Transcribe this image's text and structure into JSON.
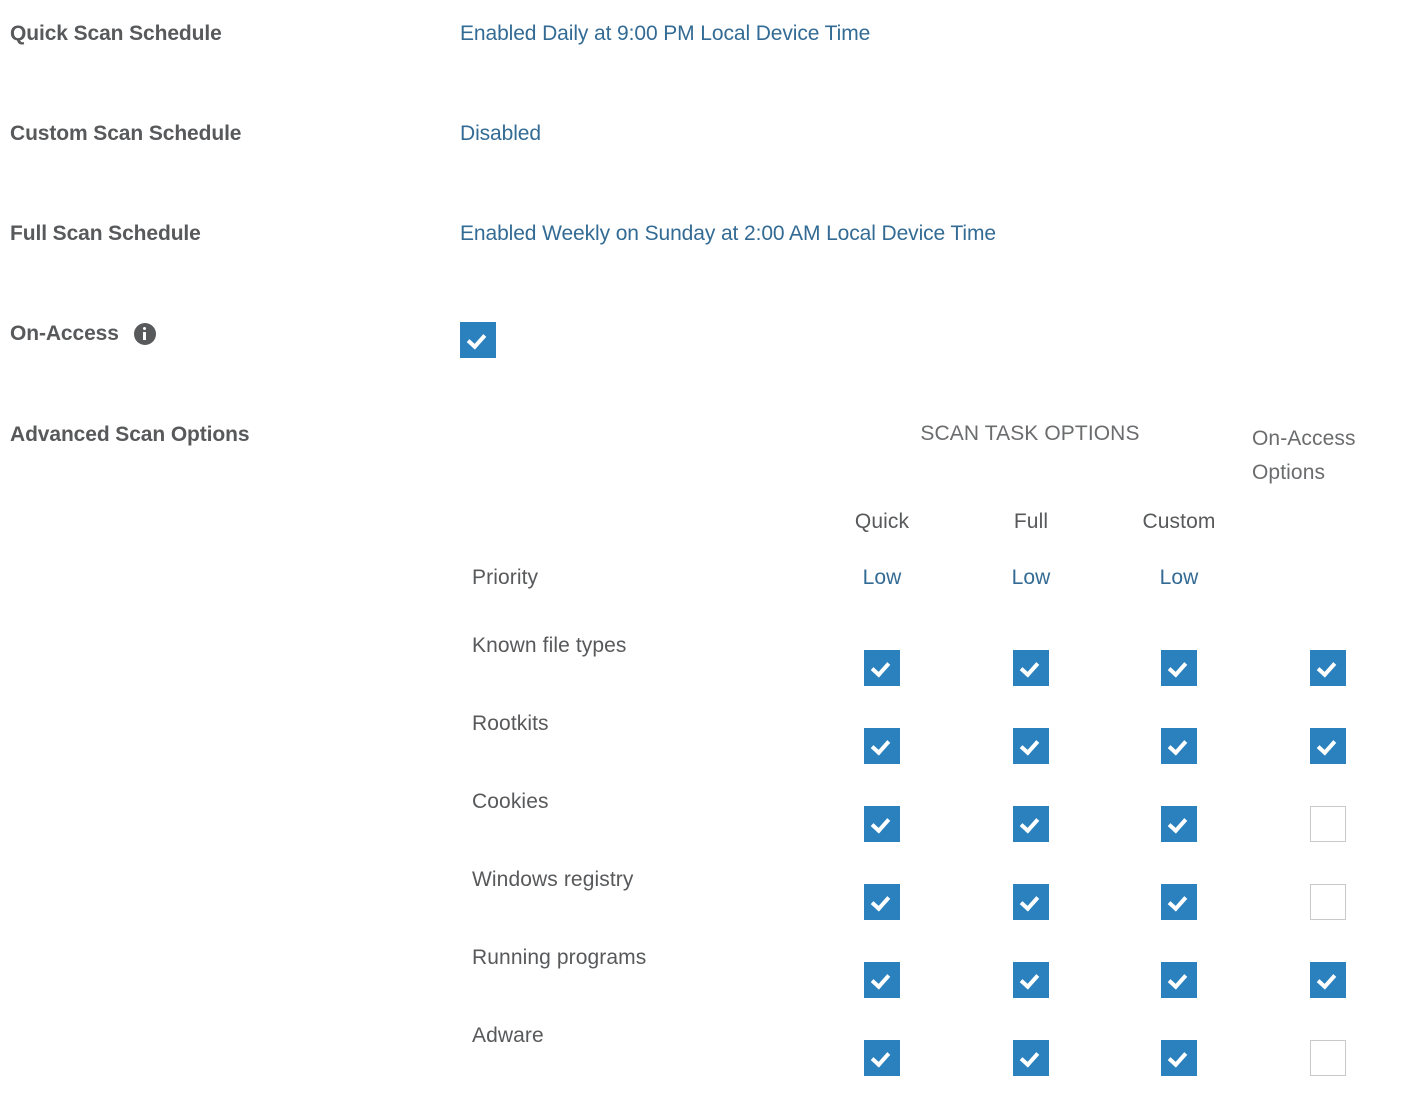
{
  "theme": {
    "link_color": "#336b94",
    "label_color": "#58595b",
    "checkbox_checked_color": "#2a81bd",
    "checkbox_border_color": "#c9c9c9",
    "background": "#ffffff"
  },
  "settings": [
    {
      "label": "Quick Scan Schedule",
      "value": "Enabled Daily at 9:00 PM Local Device Time"
    },
    {
      "label": "Custom Scan Schedule",
      "value": "Disabled"
    },
    {
      "label": "Full Scan Schedule",
      "value": "Enabled Weekly on Sunday at 2:00 AM Local Device Time"
    }
  ],
  "on_access": {
    "label": "On-Access",
    "info_icon": "info-icon",
    "checked": true
  },
  "advanced_scan_options": {
    "title": "Advanced Scan Options",
    "group_headers": {
      "scan_task_options": "SCAN TASK OPTIONS",
      "on_access_options": "On-Access Options"
    },
    "columns": [
      "Quick",
      "Full",
      "Custom"
    ],
    "priority": {
      "label": "Priority",
      "values": [
        "Low",
        "Low",
        "Low"
      ]
    },
    "rows": [
      {
        "label": "Known file types",
        "quick": true,
        "full": true,
        "custom": true,
        "on_access": true
      },
      {
        "label": "Rootkits",
        "quick": true,
        "full": true,
        "custom": true,
        "on_access": true
      },
      {
        "label": "Cookies",
        "quick": true,
        "full": true,
        "custom": true,
        "on_access": false
      },
      {
        "label": "Windows registry",
        "quick": true,
        "full": true,
        "custom": true,
        "on_access": false
      },
      {
        "label": "Running programs",
        "quick": true,
        "full": true,
        "custom": true,
        "on_access": true
      },
      {
        "label": "Adware",
        "quick": true,
        "full": true,
        "custom": true,
        "on_access": false
      }
    ]
  }
}
